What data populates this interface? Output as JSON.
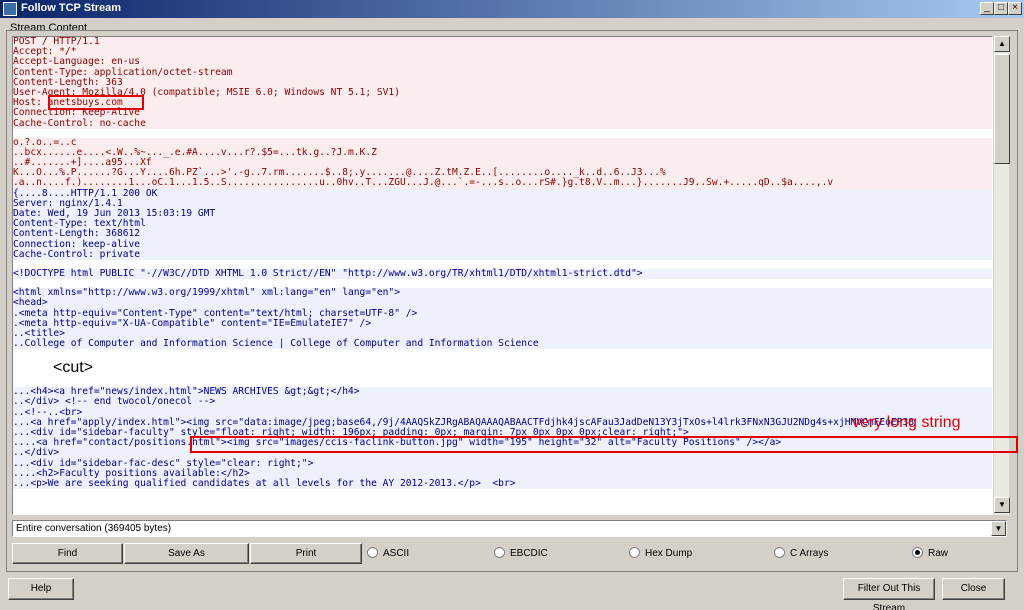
{
  "window": {
    "title": "Follow TCP Stream"
  },
  "group_label": "Stream Content",
  "stream": {
    "client_request": [
      "POST / HTTP/1.1",
      "Accept: */*",
      "Accept-Language: en-us",
      "Content-Type: application/octet-stream",
      "Content-Length: 363",
      "User-Agent: Mozilla/4.0 (compatible; MSIE 6.0; Windows NT 5.1; SV1)",
      "Host: anetsbuys.com",
      "Connection: Keep-Alive",
      "Cache-Control: no-cache"
    ],
    "client_binary": [
      "o.?.o..=..c",
      "..bcx......e....<.W..%~..._.e.#A....v...r?.$5=...tk.g..?J.m.K.Z",
      "..#.......+]....a95...Xf",
      "K...O...%.P......?G...Y....6h.PZ`...>'.-g..7.rm.......$..8;.y.......@....Z.tM.Z.E..[........o...._k..d..6..J3...%",
      ".a..n....f.)........1...oC.1...1.5..S................u..0hv..T...ZGU...J.@...`.=-...s..o...rS#.}g.t8.V..m...}.......J9..Sw.+.....qD..$a....,.v"
    ],
    "server_response": [
      "{....8....HTTP/1.1 200 OK",
      "Server: nginx/1.4.1",
      "Date: Wed, 19 Jun 2013 15:03:19 GMT",
      "Content-Type: text/html",
      "Content-Length: 368612",
      "Connection: keep-alive",
      "Cache-Control: private"
    ],
    "server_doctype": "<!DOCTYPE html PUBLIC \"-//W3C//DTD XHTML 1.0 Strict//EN\" \"http://www.w3.org/TR/xhtml1/DTD/xhtml1-strict.dtd\">",
    "server_head": [
      "<html xmlns=\"http://www.w3.org/1999/xhtml\" xml:lang=\"en\" lang=\"en\">",
      "<head>",
      ".<meta http-equiv=\"Content-Type\" content=\"text/html; charset=UTF-8\" />",
      ".<meta http-equiv=\"X-UA-Compatible\" content=\"IE=EmulateIE7\" />",
      "..<title>",
      "..College of Computer and Information Science | College of Computer and Information Science"
    ],
    "server_body": [
      "...<h4><a href=\"news/index.html\">NEWS ARCHIVES &gt;&gt;</h4>",
      "..</div> <!-- end twocol/onecol -->",
      "..<!--..<br>",
      "...<a href=\"apply/index.html\"><img src=\"data:image/jpeg;base64,/9j/4AAQSkZJRgABAQAAAQABAACTFdjhk4jscAFau3JadDeN13Y3jTxOs+l4lrk3FNxN3GJU2NDg4s+xjHMVCmFEoEP38",
      "...<div id=\"sidebar-faculty\" style=\"float: right; width: 196px; padding: 0px; margin: 7px 0px 0px 0px;clear: right;\">",
      "....<a href=\"contact/positions.html\"><img src=\"images/ccis-faclink-button.jpg\" width=\"195\" height=\"32\" alt=\"Faculty Positions\" /></a>",
      "..</div>",
      "...<div id=\"sidebar-fac-desc\" style=\"clear: right;\">",
      "....<h2>Faculty positions available:</h2>",
      "...<p>We are seeking qualified candidates at all levels for the AY 2012-2013.</p>  <br>"
    ]
  },
  "annotations": {
    "cut_label": "<cut>",
    "long_string_label": "very long string"
  },
  "conversation_select": {
    "value": "Entire conversation (369405 bytes)"
  },
  "buttons": {
    "find": "Find",
    "save_as": "Save As",
    "print": "Print",
    "help": "Help",
    "filter_out": "Filter Out This Stream",
    "close": "Close"
  },
  "formats": {
    "options": [
      "ASCII",
      "EBCDIC",
      "Hex Dump",
      "C Arrays",
      "Raw"
    ],
    "selected": "Raw"
  },
  "colors": {
    "client_text": "#8b0000",
    "client_bg": "#fbeded",
    "server_text": "#00008b",
    "server_bg": "#eef0fb",
    "annotation": "#e00000"
  }
}
